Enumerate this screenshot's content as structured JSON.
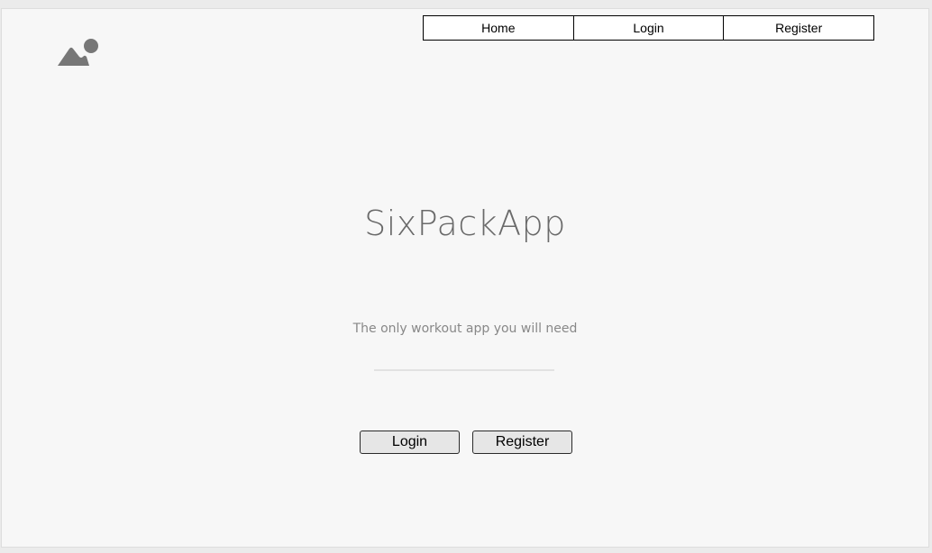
{
  "nav": {
    "items": [
      {
        "label": "Home"
      },
      {
        "label": "Login"
      },
      {
        "label": "Register"
      }
    ]
  },
  "logo": {
    "icon": "image-placeholder-icon",
    "color": "#777777"
  },
  "hero": {
    "title": "SixPackApp",
    "subtitle": "The only workout app you will need"
  },
  "actions": {
    "login_label": "Login",
    "register_label": "Register"
  }
}
